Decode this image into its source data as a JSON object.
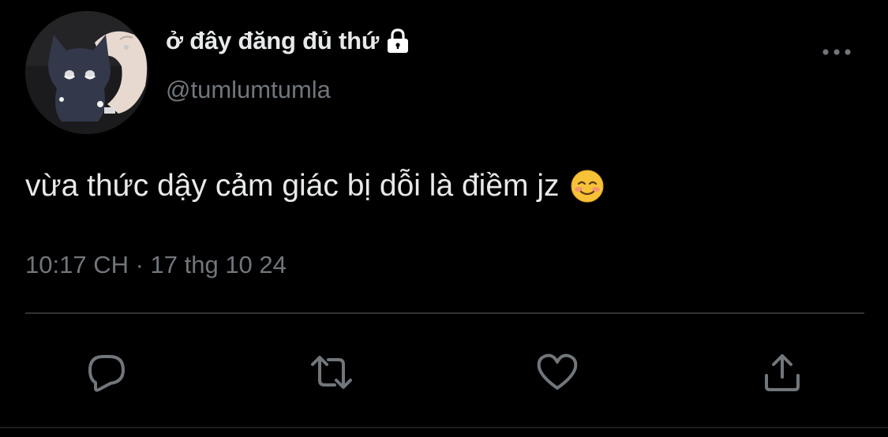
{
  "tweet": {
    "display_name": "ở đây đăng đủ thứ",
    "handle": "@tumlumtumla",
    "text": "vừa thức dậy cảm giác bị dỗi là điềm jz",
    "emoji_icon": "smiling-face-emoji",
    "timestamp": "10:17 CH · 17 thg 10 24",
    "protected_icon": "lock-icon"
  },
  "actions": {
    "reply_icon": "reply-icon",
    "retweet_icon": "retweet-icon",
    "like_icon": "heart-icon",
    "share_icon": "share-icon",
    "more_icon": "more-options-icon"
  },
  "colors": {
    "background": "#000000",
    "primary_text": "#e7e9ea",
    "secondary_text": "#71767b",
    "divider": "#2f3336"
  }
}
